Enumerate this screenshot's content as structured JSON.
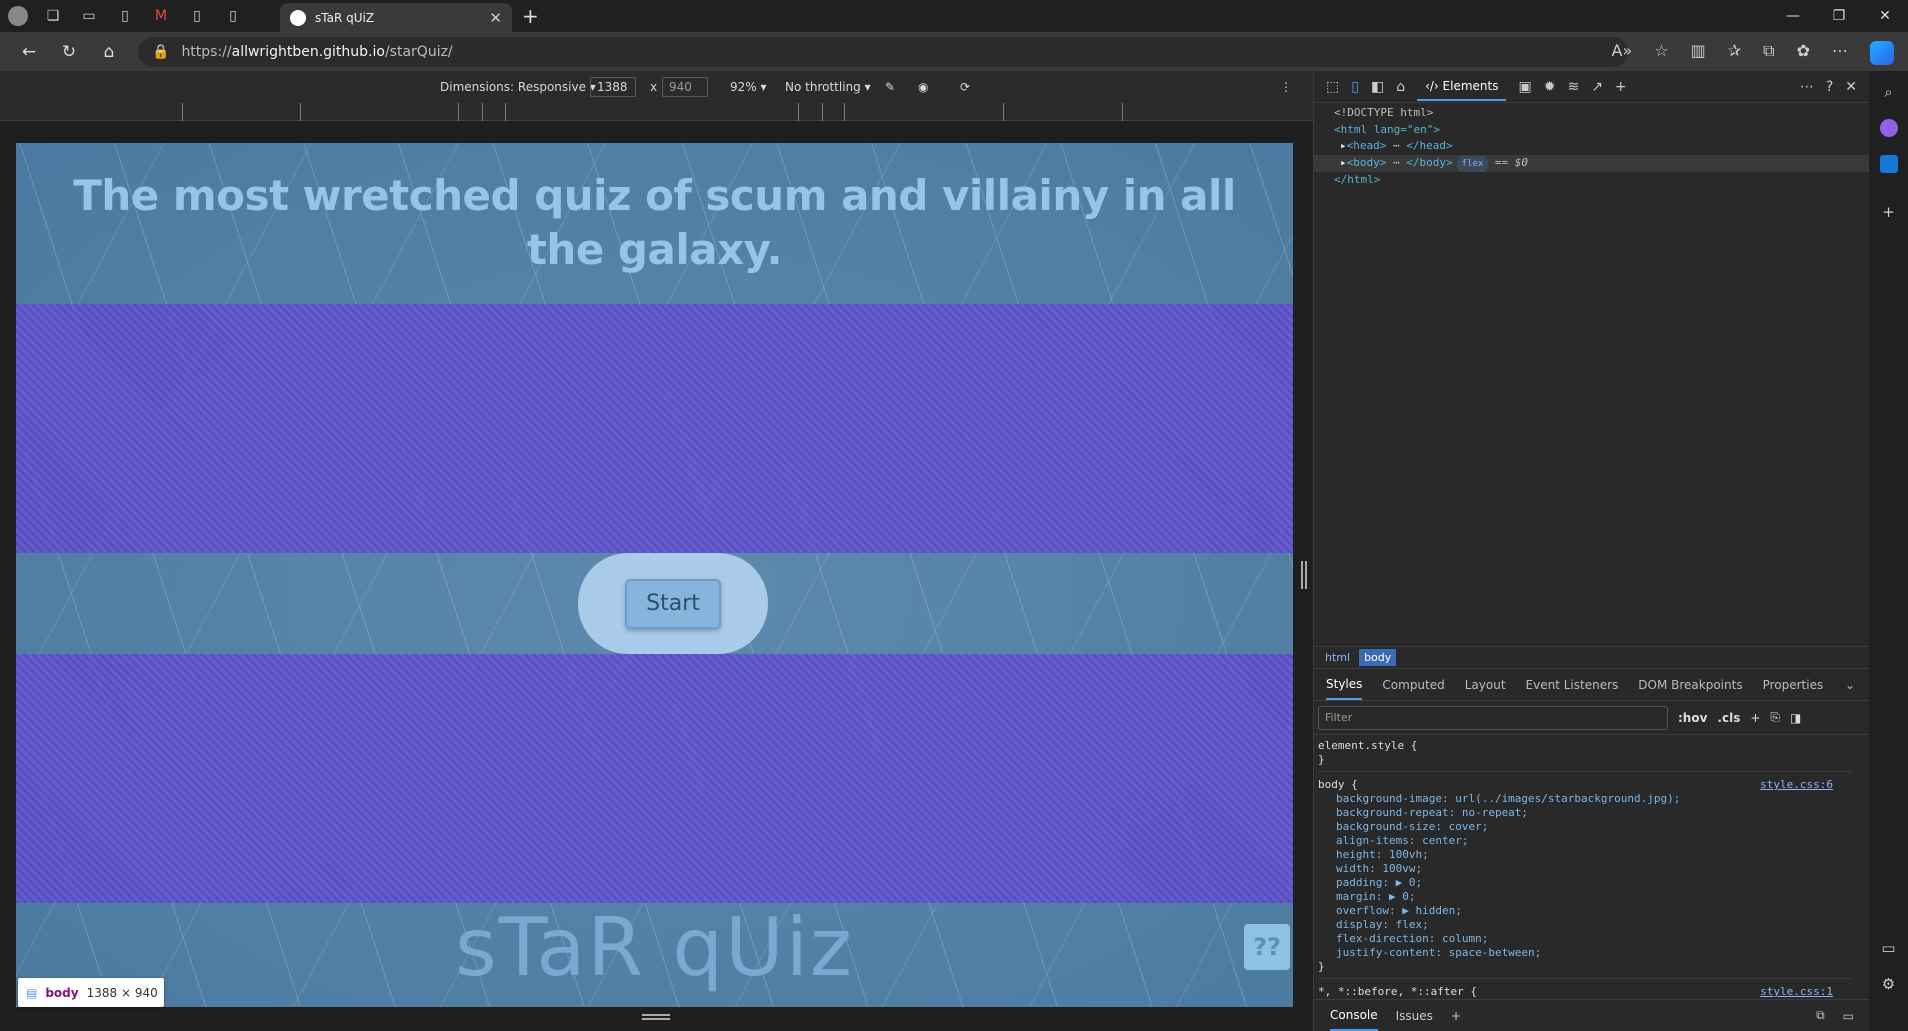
{
  "browser": {
    "tab_title": "sTaR qUiZ",
    "url_prefix": "https://",
    "url_host": "allwrightben.github.io",
    "url_path": "/starQuiz/"
  },
  "device_toolbar": {
    "dimensions_label": "Dimensions: Responsive",
    "width": "1388",
    "times": "x",
    "height": "940",
    "zoom": "92%",
    "throttling": "No throttling"
  },
  "page": {
    "title": "The most wretched quiz of scum and villainy in all the galaxy.",
    "start_label": "Start",
    "brand": "sTaR qUiz",
    "help_label": "??"
  },
  "colors": {
    "page_blue": "#5280a5",
    "band_purple": "#6b55d7",
    "title_color": "#94c4e8",
    "button_pill": "#a9cbe9"
  },
  "size_badge": {
    "tag": "body",
    "size": "1388 × 940"
  },
  "devtools": {
    "active_tab": "Elements",
    "tree": {
      "doctype": "<!DOCTYPE html>",
      "html_open": "<html lang=\"en\">",
      "head": "<head>",
      "head_close": "</head>",
      "body": "<body>",
      "body_close": "</body>",
      "flex_badge": "flex",
      "sel_ref": "== $0",
      "html_close": "</html>"
    },
    "breadcrumbs": [
      "html",
      "body"
    ],
    "subtabs": [
      "Styles",
      "Computed",
      "Layout",
      "Event Listeners",
      "DOM Breakpoints",
      "Properties"
    ],
    "filter_placeholder": "Filter",
    "hov": ":hov",
    "cls": ".cls",
    "element_style": "element.style {",
    "close_brace": "}",
    "body_selector": "body {",
    "body_source": "style.css:6",
    "body_props": [
      "background-image: url(../images/starbackground.jpg);",
      "background-repeat: no-repeat;",
      "background-size: cover;",
      "align-items: center;",
      "height: 100vh;",
      "width: 100vw;",
      "padding: ▶ 0;",
      "margin: ▶ 0;",
      "overflow: ▶ hidden;",
      "display: flex;",
      "flex-direction: column;",
      "justify-content: space-between;"
    ],
    "universal_selector": "*, *::before, *::after {",
    "universal_source": "style.css:1",
    "bottom_tabs": [
      "Console",
      "Issues"
    ]
  }
}
